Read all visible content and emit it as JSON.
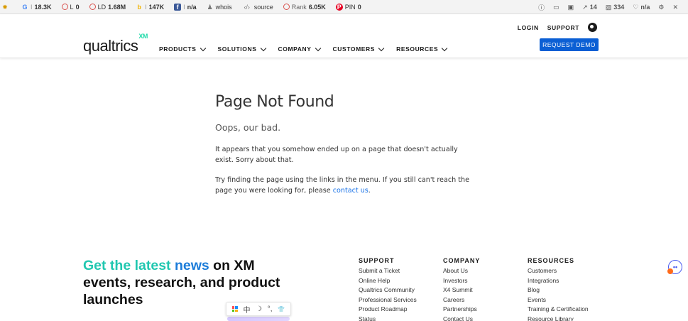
{
  "seobar": {
    "items": [
      {
        "label": "",
        "value": "",
        "icon": "plugin-icon"
      },
      {
        "label": "G",
        "value": "18.3K",
        "icon": "google-icon"
      },
      {
        "label": "L",
        "value": "0",
        "icon": "link-icon"
      },
      {
        "label": "LD",
        "value": "1.68M",
        "icon": "linking-domains-icon"
      },
      {
        "label": "b",
        "value": "147K",
        "icon": "bing-icon"
      },
      {
        "label": "I",
        "value": "n/a",
        "icon": "facebook-icon"
      },
      {
        "label": "whois",
        "value": "",
        "icon": "person-icon"
      },
      {
        "label": "source",
        "value": "",
        "icon": "code-icon"
      },
      {
        "label": "Rank",
        "value": "6.05K",
        "icon": "rank-icon"
      },
      {
        "label": "PIN",
        "value": "0",
        "icon": "pinterest-icon"
      }
    ],
    "right": [
      {
        "value": "",
        "icon": "info-icon"
      },
      {
        "value": "",
        "icon": "monitor-icon"
      },
      {
        "value": "",
        "icon": "page-icon"
      },
      {
        "value": "14",
        "icon": "external-link-icon"
      },
      {
        "value": "334",
        "icon": "image-icon"
      },
      {
        "value": "n/a",
        "icon": "heart-icon"
      },
      {
        "value": "",
        "icon": "settings-icon"
      },
      {
        "value": "",
        "icon": "close-icon"
      }
    ]
  },
  "header": {
    "logo_text": "qualtrics",
    "logo_sup": "XM",
    "nav": [
      "PRODUCTS",
      "SOLUTIONS",
      "COMPANY",
      "CUSTOMERS",
      "RESOURCES"
    ],
    "login": "LOGIN",
    "support": "SUPPORT",
    "cta": "REQUEST DEMO"
  },
  "main": {
    "title": "Page Not Found",
    "subtitle": "Oops, our bad.",
    "p1": "It appears that you somehow ended up on a page that doesn't actually exist. Sorry about that.",
    "p2_prefix": "Try finding the page using the links in the menu. If you still can't reach the page you were looking for, please",
    "p2_link": "contact us",
    "p2_suffix": "."
  },
  "footer": {
    "cta_part1": "Get the latest",
    "cta_part2": "news",
    "cta_part3": "on XM events, research, and product launches",
    "columns": [
      {
        "heading": "SUPPORT",
        "links": [
          "Submit a Ticket",
          "Online Help",
          "Qualtrics Community",
          "Professional Services",
          "Product Roadmap",
          "Status"
        ]
      },
      {
        "heading": "COMPANY",
        "links": [
          "About Us",
          "Investors",
          "X4 Summit",
          "Careers",
          "Partnerships",
          "Contact Us"
        ]
      },
      {
        "heading": "RESOURCES",
        "links": [
          "Customers",
          "Integrations",
          "Blog",
          "Events",
          "Training & Certification",
          "Resource Library"
        ]
      }
    ]
  },
  "ime": {
    "chars": [
      "中",
      "☽",
      "°,",
      "👕"
    ]
  },
  "colors": {
    "accent_blue": "#0b5fd4",
    "cta_green": "#21c7b0",
    "cta_blue": "#1b7cd9",
    "link_blue": "#1a73e8"
  }
}
